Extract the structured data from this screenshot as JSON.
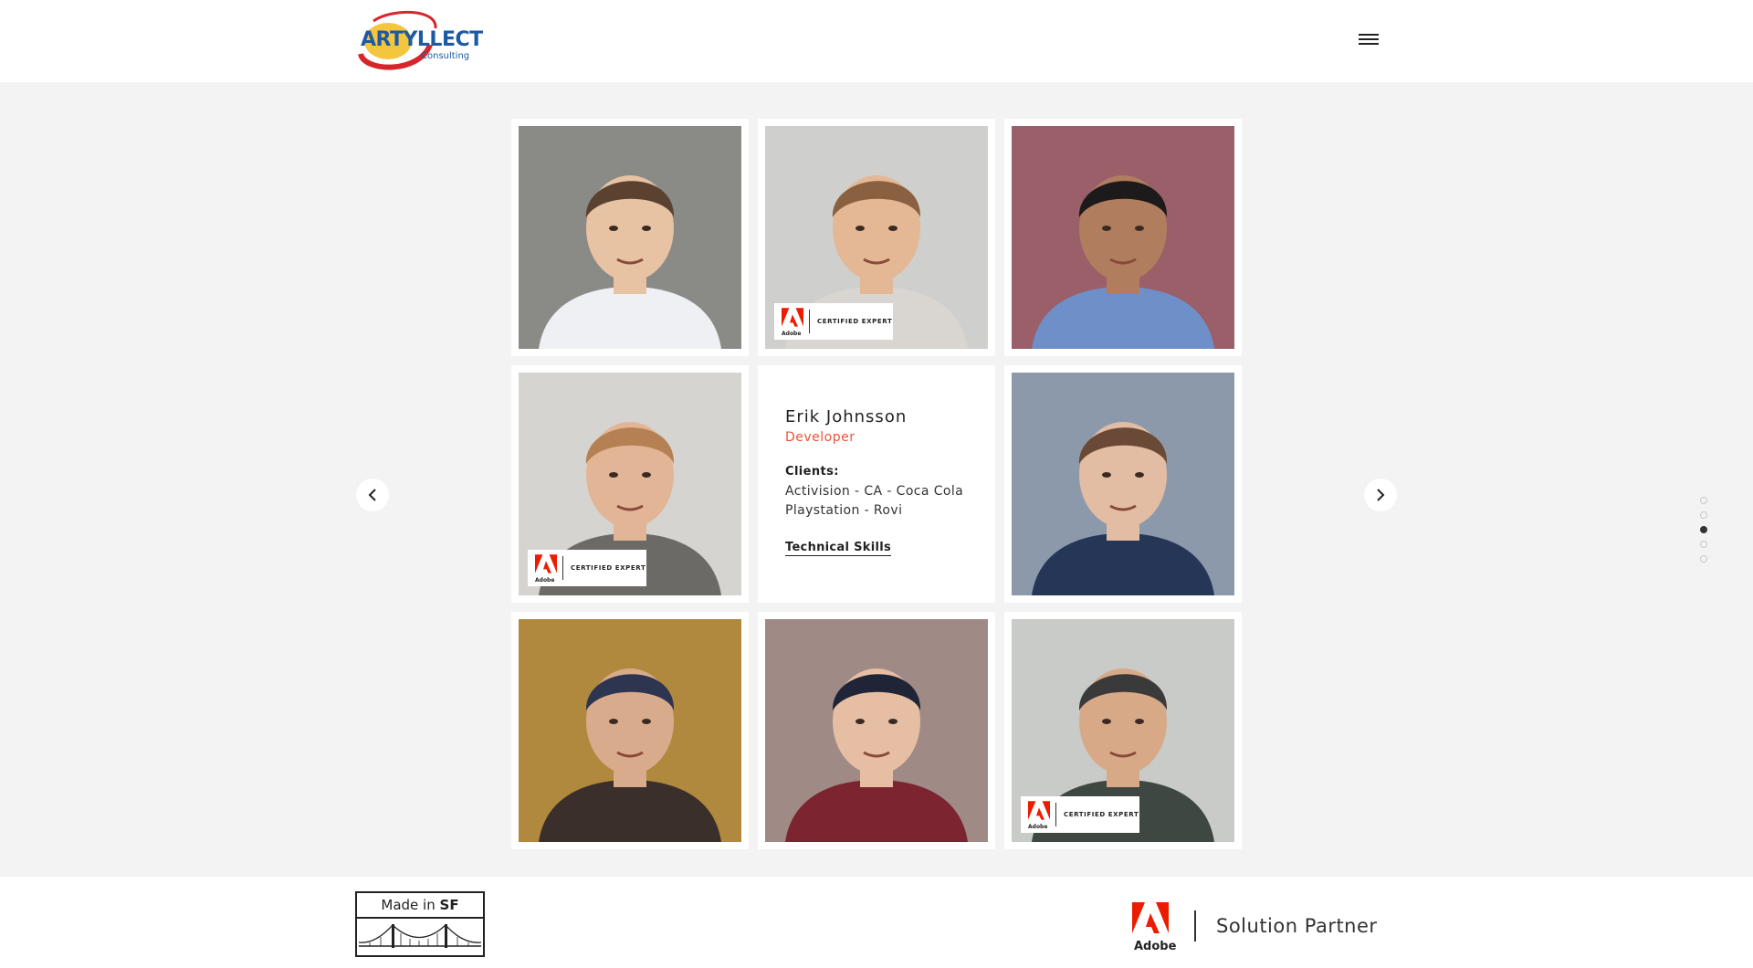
{
  "header": {
    "logo_text": "ARTYLLECT",
    "logo_subtext": "Consulting"
  },
  "badge_text": "CERTIFIED EXPERT",
  "adobe_word": "Adobe",
  "team": {
    "featured": {
      "name": "Erik Johnsson",
      "role": "Developer",
      "clients_heading": "Clients:",
      "clients_line1": "Activision - CA - Coca Cola",
      "clients_line2": "Playstation - Rovi",
      "skills_link": "Technical Skills"
    },
    "members": [
      {
        "certified": false,
        "bg": "#8a8a86",
        "skin": "#e7c2a3",
        "hair": "#5b4230",
        "shirt": "#eef0f4"
      },
      {
        "certified": true,
        "bg": "#cfcfcd",
        "skin": "#e4b795",
        "hair": "#8a6140",
        "shirt": "#d9d6d2"
      },
      {
        "certified": false,
        "bg": "#9a5f68",
        "skin": "#b07d5e",
        "hair": "#1d1a1b",
        "shirt": "#6f8fc9"
      },
      {
        "certified": true,
        "bg": "#d6d4d0",
        "skin": "#e3b597",
        "hair": "#b58052",
        "shirt": "#6c6a66"
      },
      {
        "certified": false,
        "bg": "#8c99aa",
        "skin": "#e3bda3",
        "hair": "#6a4a36",
        "shirt": "#263656"
      },
      {
        "certified": false,
        "bg": "#b0893e",
        "skin": "#d9ab8d",
        "hair": "#2e3550",
        "shirt": "#3a2f2a"
      },
      {
        "certified": false,
        "bg": "#9f8a86",
        "skin": "#e6bea3",
        "hair": "#1f2437",
        "shirt": "#7c2531"
      },
      {
        "certified": true,
        "bg": "#c9cbc8",
        "skin": "#d8a987",
        "hair": "#3b3a3a",
        "shirt": "#3f4742"
      }
    ]
  },
  "pagination": {
    "count": 5,
    "active": 2
  },
  "footer": {
    "made_in_prefix": "Made in ",
    "made_in_city": "SF",
    "partner_text": "Solution Partner"
  },
  "colors": {
    "accent": "#e8563b",
    "adobe_red": "#eb1c00",
    "logo_blue": "#1d5aa3"
  }
}
